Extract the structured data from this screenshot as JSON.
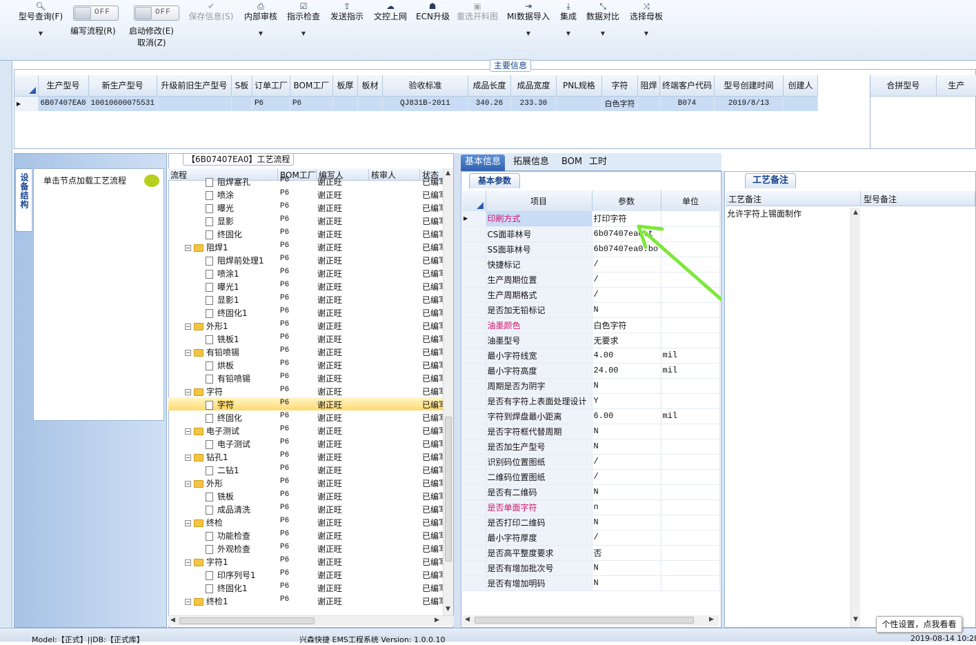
{
  "toolbar": {
    "items": [
      {
        "label": "型号查询(F)",
        "icon": "search-icon"
      },
      {
        "label": "保存信息(S)",
        "icon": "check-icon"
      },
      {
        "label": "内部审核",
        "icon": "printer-icon"
      },
      {
        "label": "指示检查",
        "icon": "checkbox-icon"
      },
      {
        "label": "发送指示",
        "icon": "upload-icon"
      },
      {
        "label": "文控上网",
        "icon": "cloud-upload-icon"
      },
      {
        "label": "ECN升级",
        "icon": "person-icon"
      },
      {
        "label": "重选开料图",
        "icon": "image-icon"
      },
      {
        "label": "MI数据导入",
        "icon": "import-icon"
      },
      {
        "label": "集成",
        "icon": "download-icon"
      },
      {
        "label": "数据对比",
        "icon": "compare-icon"
      },
      {
        "label": "选择母板",
        "icon": "shuffle-icon"
      }
    ],
    "toggle_text": "OFF",
    "edit_flow_label": "编写流程(R)",
    "start_modify_label": "启动修改(E)",
    "cancel_label": "取消(Z)"
  },
  "main_info": {
    "title": "主要信息",
    "columns": [
      "生产型号",
      "新生产型号",
      "升级前旧生产型号",
      "S板",
      "订单工厂",
      "BOM工厂",
      "板厚",
      "板材",
      "验收标准",
      "成品长度",
      "成品宽度",
      "PNL规格",
      "字符",
      "阻焊",
      "终端客户代码",
      "型号创建时间",
      "创建人"
    ],
    "row": [
      "6B07407EA0",
      "10010600075531",
      "",
      "",
      "P6",
      "P6",
      "",
      "",
      "QJ831B-2011",
      "340.26",
      "233.30",
      "",
      "白色字符",
      "",
      "B074",
      "2019/8/13",
      ""
    ],
    "right_columns": [
      "合拼型号",
      "生产"
    ]
  },
  "left_panel": {
    "tab_label": "设备结构",
    "hint": "单击节点加载工艺流程",
    "chat_icon": "chat-bubble-icon"
  },
  "flow": {
    "title": "【6B07407EA0】工艺流程",
    "columns": [
      "流程",
      "BOM工厂",
      "编写人",
      "核审人",
      "状态"
    ],
    "rows": [
      {
        "name": "阻焊塞孔",
        "level": 2,
        "type": "doc",
        "bom": "P6",
        "writer": "谢正旺",
        "status": "已编写"
      },
      {
        "name": "喷涂",
        "level": 2,
        "type": "doc",
        "bom": "P6",
        "writer": "谢正旺",
        "status": "已编写"
      },
      {
        "name": "曝光",
        "level": 2,
        "type": "doc",
        "bom": "P6",
        "writer": "谢正旺",
        "status": "已编写"
      },
      {
        "name": "显影",
        "level": 2,
        "type": "doc",
        "bom": "P6",
        "writer": "谢正旺",
        "status": "已编写"
      },
      {
        "name": "终固化",
        "level": 2,
        "type": "doc",
        "bom": "P6",
        "writer": "谢正旺",
        "status": "已编写"
      },
      {
        "name": "阻焊1",
        "level": 1,
        "type": "folder",
        "bom": "P6",
        "writer": "谢正旺",
        "status": "已编写"
      },
      {
        "name": "阻焊前处理1",
        "level": 2,
        "type": "doc",
        "bom": "P6",
        "writer": "谢正旺",
        "status": "已编写"
      },
      {
        "name": "喷涂1",
        "level": 2,
        "type": "doc",
        "bom": "P6",
        "writer": "谢正旺",
        "status": "已编写"
      },
      {
        "name": "曝光1",
        "level": 2,
        "type": "doc",
        "bom": "P6",
        "writer": "谢正旺",
        "status": "已编写"
      },
      {
        "name": "显影1",
        "level": 2,
        "type": "doc",
        "bom": "P6",
        "writer": "谢正旺",
        "status": "已编写"
      },
      {
        "name": "终固化1",
        "level": 2,
        "type": "doc",
        "bom": "P6",
        "writer": "谢正旺",
        "status": "已编写"
      },
      {
        "name": "外形1",
        "level": 1,
        "type": "folder",
        "bom": "P6",
        "writer": "谢正旺",
        "status": "已编写"
      },
      {
        "name": "铣板1",
        "level": 2,
        "type": "doc",
        "bom": "P6",
        "writer": "谢正旺",
        "status": "已编写"
      },
      {
        "name": "有铅喷锡",
        "level": 1,
        "type": "folder",
        "bom": "P6",
        "writer": "谢正旺",
        "status": "已编写"
      },
      {
        "name": "烘板",
        "level": 2,
        "type": "doc",
        "bom": "P6",
        "writer": "谢正旺",
        "status": "已编写"
      },
      {
        "name": "有铅喷锡",
        "level": 2,
        "type": "doc",
        "bom": "P6",
        "writer": "谢正旺",
        "status": "已编写"
      },
      {
        "name": "字符",
        "level": 1,
        "type": "folder",
        "bom": "P6",
        "writer": "谢正旺",
        "status": "已编写"
      },
      {
        "name": "字符",
        "level": 2,
        "type": "doc",
        "bom": "P6",
        "writer": "谢正旺",
        "status": "已编写",
        "selected": true
      },
      {
        "name": "终固化",
        "level": 2,
        "type": "doc",
        "bom": "P6",
        "writer": "谢正旺",
        "status": "已编写"
      },
      {
        "name": "电子测试",
        "level": 1,
        "type": "folder",
        "bom": "P6",
        "writer": "谢正旺",
        "status": "已编写"
      },
      {
        "name": "电子测试",
        "level": 2,
        "type": "doc",
        "bom": "P6",
        "writer": "谢正旺",
        "status": "已编写"
      },
      {
        "name": "钻孔1",
        "level": 1,
        "type": "folder",
        "bom": "P6",
        "writer": "谢正旺",
        "status": "已编写"
      },
      {
        "name": "二钻1",
        "level": 2,
        "type": "doc",
        "bom": "P6",
        "writer": "谢正旺",
        "status": "已编写"
      },
      {
        "name": "外形",
        "level": 1,
        "type": "folder",
        "bom": "P6",
        "writer": "谢正旺",
        "status": "已编写"
      },
      {
        "name": "铣板",
        "level": 2,
        "type": "doc",
        "bom": "P6",
        "writer": "谢正旺",
        "status": "已编写"
      },
      {
        "name": "成品清洗",
        "level": 2,
        "type": "doc",
        "bom": "P6",
        "writer": "谢正旺",
        "status": "已编写"
      },
      {
        "name": "终检",
        "level": 1,
        "type": "folder",
        "bom": "P6",
        "writer": "谢正旺",
        "status": "已编写"
      },
      {
        "name": "功能检查",
        "level": 2,
        "type": "doc",
        "bom": "P6",
        "writer": "谢正旺",
        "status": "已编写"
      },
      {
        "name": "外观检查",
        "level": 2,
        "type": "doc",
        "bom": "P6",
        "writer": "谢正旺",
        "status": "已编写"
      },
      {
        "name": "字符1",
        "level": 1,
        "type": "folder",
        "bom": "P6",
        "writer": "谢正旺",
        "status": "已编写"
      },
      {
        "name": "印序列号1",
        "level": 2,
        "type": "doc",
        "bom": "P6",
        "writer": "谢正旺",
        "status": "已编写"
      },
      {
        "name": "终固化1",
        "level": 2,
        "type": "doc",
        "bom": "P6",
        "writer": "谢正旺",
        "status": "已编写"
      },
      {
        "name": "终检1",
        "level": 1,
        "type": "folder",
        "bom": "P6",
        "writer": "谢正旺",
        "status": "已编写"
      }
    ]
  },
  "detail": {
    "tabs": [
      "基本信息",
      "拓展信息",
      "BOM",
      "工时"
    ],
    "sub_tab": "基本参数",
    "columns": [
      "项目",
      "参数",
      "单位"
    ],
    "rows": [
      {
        "item": "印刷方式",
        "value": "打印字符",
        "unit": "",
        "red": true,
        "selected": true
      },
      {
        "item": "CS面菲林号",
        "value": "6b07407ea0.t",
        "unit": ""
      },
      {
        "item": "SS面菲林号",
        "value": "6b07407ea0.bo",
        "unit": ""
      },
      {
        "item": "快捷标记",
        "value": "/",
        "unit": ""
      },
      {
        "item": "生产周期位置",
        "value": "/",
        "unit": ""
      },
      {
        "item": "生产周期格式",
        "value": "/",
        "unit": ""
      },
      {
        "item": "是否加无铅标记",
        "value": "N",
        "unit": ""
      },
      {
        "item": "油墨颜色",
        "value": "白色字符",
        "unit": "",
        "red": true
      },
      {
        "item": "油墨型号",
        "value": "无要求",
        "unit": ""
      },
      {
        "item": "最小字符线宽",
        "value": "4.00",
        "unit": "mil"
      },
      {
        "item": "最小字符高度",
        "value": "24.00",
        "unit": "mil"
      },
      {
        "item": "周期是否为阴字",
        "value": "N",
        "unit": ""
      },
      {
        "item": "是否有字符上表面处理设计",
        "value": "Y",
        "unit": ""
      },
      {
        "item": "字符到焊盘最小距离",
        "value": "6.00",
        "unit": "mil"
      },
      {
        "item": "是否字符框代替周期",
        "value": "N",
        "unit": ""
      },
      {
        "item": "是否加生产型号",
        "value": "N",
        "unit": ""
      },
      {
        "item": "识别码位置图纸",
        "value": "/",
        "unit": ""
      },
      {
        "item": "二维码位置图纸",
        "value": "/",
        "unit": ""
      },
      {
        "item": "是否有二维码",
        "value": "N",
        "unit": ""
      },
      {
        "item": "是否单面字符",
        "value": "n",
        "unit": "",
        "red": true
      },
      {
        "item": "是否打印二维码",
        "value": "N",
        "unit": ""
      },
      {
        "item": "最小字符厚度",
        "value": "/",
        "unit": ""
      },
      {
        "item": "是否高平整度要求",
        "value": "否",
        "unit": ""
      },
      {
        "item": "是否有增加批次号",
        "value": "N",
        "unit": ""
      },
      {
        "item": "是否有增加明码",
        "value": "N",
        "unit": ""
      }
    ]
  },
  "remarks": {
    "tab": "工艺备注",
    "col1": "工艺备注",
    "col2": "型号备注",
    "text": "允许字符上锡面制作"
  },
  "status": {
    "left": "Model:【正式】||DB:【正式库】",
    "center": "兴森快捷 EMS工程系统 Version: 1.0.0.10",
    "right": "2019-08-14 10:28",
    "tooltip": "个性设置，点我看看"
  },
  "colors": {
    "accent": "#2f62b0",
    "selection": "#ffd970",
    "red_label": "#d0146e",
    "arrow": "#7ee83a"
  }
}
